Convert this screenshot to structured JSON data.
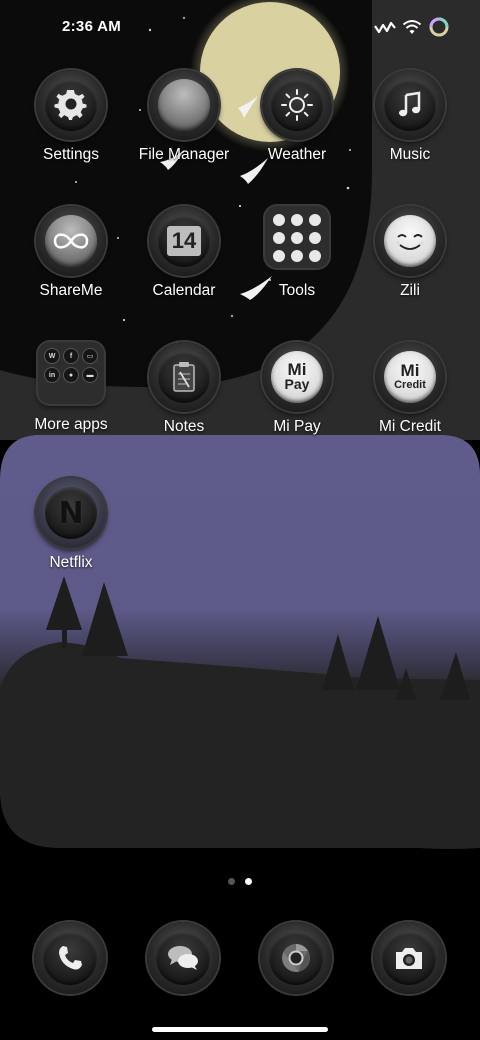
{
  "status_bar": {
    "time": "2:36 AM",
    "icons": [
      "signal-icon",
      "wifi-icon",
      "battery-ring-icon"
    ]
  },
  "apps": [
    {
      "label": "Settings",
      "icon": "gear-icon"
    },
    {
      "label": "File Manager",
      "icon": "folder-sphere-icon"
    },
    {
      "label": "Weather",
      "icon": "sun-icon"
    },
    {
      "label": "Music",
      "icon": "music-note-icon"
    },
    {
      "label": "ShareMe",
      "icon": "infinity-icon"
    },
    {
      "label": "Calendar",
      "icon": "calendar-icon",
      "date": "14"
    },
    {
      "label": "Tools",
      "icon": "tools-folder-icon"
    },
    {
      "label": "Zili",
      "icon": "smiley-icon"
    },
    {
      "label": "More apps",
      "icon": "apps-folder-icon",
      "folder_items": [
        "W",
        "f",
        "▭",
        "in",
        "●",
        "▬"
      ]
    },
    {
      "label": "Notes",
      "icon": "notepad-icon"
    },
    {
      "label": "Mi Pay",
      "icon": "mi-pay-icon",
      "badge_top": "Mi",
      "badge_bottom": "Pay"
    },
    {
      "label": "Mi Credit",
      "icon": "mi-credit-icon",
      "badge_top": "Mi",
      "badge_bottom": "Credit"
    },
    {
      "label": "Netflix",
      "icon": "netflix-icon",
      "letter": "N"
    }
  ],
  "dock": [
    {
      "name": "phone",
      "icon": "phone-icon"
    },
    {
      "name": "messages",
      "icon": "chat-bubbles-icon"
    },
    {
      "name": "browser",
      "icon": "chrome-icon"
    },
    {
      "name": "camera",
      "icon": "camera-icon"
    }
  ],
  "pages": {
    "count": 2,
    "active": 2
  },
  "colors": {
    "background": "#000000",
    "moon": "#d9d1a0",
    "night_sky": "#0b0b0b",
    "hill_grey": "#2a2a2a",
    "dusk_purple": "#5f5c8c",
    "silhouette": "#222222"
  }
}
